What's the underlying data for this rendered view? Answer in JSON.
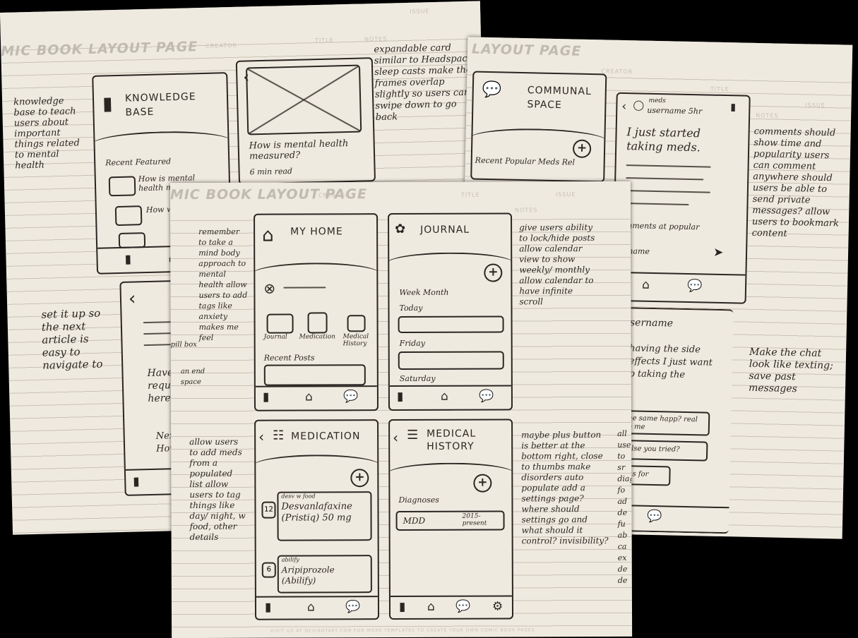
{
  "sheet_left": {
    "page_title": "MIC BOOK LAYOUT PAGE",
    "header_labels": [
      "CREATOR",
      "TITLE",
      "ISSUE",
      "NOTES"
    ],
    "note_kb": "knowledge base to teach users about important things related to mental health",
    "note_next": "set it up so the next article is easy to navigate to",
    "note_card": "expandable card similar to Headspace sleep casts make the frames overlap slightly so users can swipe down to go back",
    "kb_title": "KNOWLEDGE BASE",
    "kb_tabs": "Recent   Featured",
    "kb_item1": "How is mental health measured?",
    "kb_item2": "How wor",
    "article_title": "How is mental health measured?",
    "article_read": "6 min read",
    "detail_text": "Have s reque here",
    "detail_next": "Next How"
  },
  "sheet_right": {
    "page_title": "LAYOUT PAGE",
    "header_labels": [
      "CREATOR",
      "TITLE",
      "ISSUE",
      "NOTES"
    ],
    "communal_title": "COMMUNAL SPACE",
    "communal_tabs": "Recent  Popular  Meds  Rel",
    "post_meta": "username 5hr",
    "post_tag": "meds",
    "post_text": "I just started taking meds.",
    "post_comments": "mments  at popular",
    "post_user2": "rname",
    "chat_user": "sername",
    "chat_text": "having the side effects I just want p taking the",
    "chat_bubble1": "the same happ? real to me",
    "chat_bubble2": "else you tried?",
    "chat_bubble3": "oks for",
    "note_comments": "comments should show time and popularity users can comment anywhere should users be able to send private messages? allow users to bookmark content",
    "note_chat": "Make the chat look like texting; save past messages"
  },
  "sheet_front": {
    "page_title": "MIC BOOK LAYOUT PAGE",
    "header_labels": [
      "CREATOR",
      "TITLE",
      "ISSUE",
      "NOTES"
    ],
    "note_home": "remember to take a mind body approach to mental health allow users to add tags like anxiety makes me feel",
    "quote1": "pill box",
    "quote2": "an end space",
    "home_title": "MY HOME",
    "home_icons": [
      "Journal",
      "Medication",
      "Medical History"
    ],
    "home_recent": "Recent Posts",
    "journal_title": "JOURNAL",
    "journal_tabs": "Week  Month",
    "journal_days": [
      "Today",
      "Friday",
      "Saturday"
    ],
    "note_journal": "give users ability to lock/hide posts allow calendar view to show weekly/ monthly allow calendar to have infinite scroll",
    "medication_title": "MEDICATION",
    "med1_tags": "desv  w food",
    "med1_name": "Desvanlafaxine (Pristiq) 50 mg",
    "med1_day": "12",
    "med2_tag": "abilify",
    "med2_name": "Aripiprozole (Abilify)",
    "med2_day": "6",
    "note_meds": "allow users to add meds from a populated list allow users to tag things like day/ night, w food, other details",
    "history_title": "MEDICAL HISTORY",
    "history_label": "Diagnoses",
    "history_item": "MDD",
    "history_years": "2015- present",
    "note_history": "maybe plus button is better at the bottom right, close to thumbs make disorders auto populate add a settings page? where should settings go and what should it control? invisibility?",
    "edge_notes": "all use to sr diag fo ad de fu ab ca ex de de",
    "footer": "VISIT US AT DEVIANTART.COM FOR MORE TEMPLATES TO CREATE YOUR OWN COMIC BOOK PAGES"
  }
}
